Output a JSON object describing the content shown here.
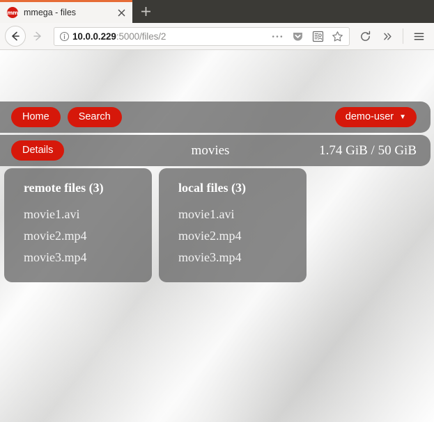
{
  "browser": {
    "tab": {
      "favicon_label": "mm",
      "favicon_icon": "mmega-logo-icon",
      "title": "mmega - files",
      "close_icon": "close-icon"
    },
    "new_tab_icon": "plus-icon",
    "back_icon": "back-arrow-icon",
    "forward_icon": "forward-arrow-icon",
    "urlbar": {
      "info_icon": "info-circle-icon",
      "host": "10.0.0.229",
      "path": ":5000/files/2",
      "full_url": "10.0.0.229:5000/files/2",
      "page_actions_icon": "ellipsis-icon",
      "pocket_icon": "pocket-shield-icon",
      "reader_icon": "reader-mode-icon",
      "bookmark_icon": "star-icon"
    },
    "reload_icon": "reload-icon",
    "overflow_icon": "double-chevron-right-icon",
    "menu_icon": "hamburger-menu-icon"
  },
  "app": {
    "topnav": {
      "home_label": "Home",
      "search_label": "Search",
      "user_label": "demo-user",
      "user_caret": "▼"
    },
    "pathnav": {
      "details_label": "Details",
      "folder_title": "movies",
      "storage_quota": "1.74 GiB / 50 GiB"
    },
    "cards": [
      {
        "heading": "remote files (3)",
        "files": [
          "movie1.avi",
          "movie2.mp4",
          "movie3.mp4"
        ]
      },
      {
        "heading": "local files (3)",
        "files": [
          "movie1.avi",
          "movie2.mp4",
          "movie3.mp4"
        ]
      }
    ]
  },
  "colors": {
    "accent_red": "#d6180a",
    "tab_active_border": "#e66c36",
    "chrome_dark": "#3b3a36",
    "panel_gray": "rgba(109,109,109,.80)"
  }
}
